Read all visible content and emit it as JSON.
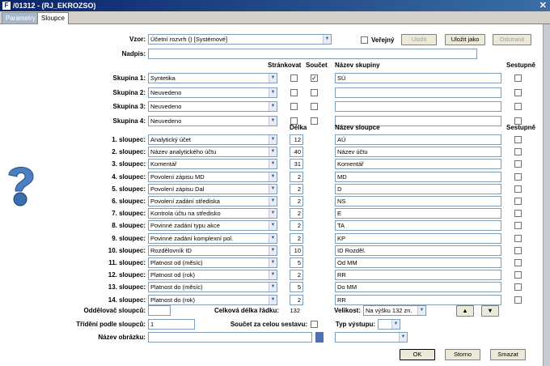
{
  "window": {
    "title": "/01312 - (RJ_EKROZSO)",
    "close_glyph": "✕"
  },
  "tabs": [
    {
      "label": "Parametry"
    },
    {
      "label": "Sloupce"
    }
  ],
  "vzor": {
    "label": "Vzor:",
    "value": "Účetní rozvrh   ()   [Systémové]",
    "verejny_label": "Veřejný",
    "uloz_label": "Uložit",
    "uloz_jako_label": "Uložit jako",
    "odstranit_label": "Odstranit"
  },
  "nadpis": {
    "label": "Nadpis:",
    "value": ""
  },
  "group_headers": {
    "strankovat": "Stránkovat",
    "soucet": "Součet",
    "nazev_skupiny": "Název skupiny",
    "sestupne": "Sestupně"
  },
  "groups": [
    {
      "label": "Skupina 1:",
      "value": "Syntetika",
      "strankovat": false,
      "soucet": true,
      "name": "SÚ",
      "sestupne": false
    },
    {
      "label": "Skupina 2:",
      "value": "Neuvedeno",
      "strankovat": false,
      "soucet": false,
      "name": "",
      "sestupne": false
    },
    {
      "label": "Skupina 3:",
      "value": "Neuvedeno",
      "strankovat": false,
      "soucet": false,
      "name": "",
      "sestupne": false
    },
    {
      "label": "Skupina 4:",
      "value": "Neuvedeno",
      "strankovat": false,
      "soucet": false,
      "name": "",
      "sestupne": false
    }
  ],
  "column_headers": {
    "delka": "Délka",
    "nazev_sloupce": "Název sloupce",
    "sestupne": "Sestupně"
  },
  "columns": [
    {
      "label": "1. sloupec:",
      "value": "Analytický účet",
      "delka": "12",
      "name": "AÚ"
    },
    {
      "label": "2. sloupec:",
      "value": "Název analytického účtu",
      "delka": "40",
      "name": "Název účtu"
    },
    {
      "label": "3. sloupec:",
      "value": "Komentář",
      "delka": "31",
      "name": "Komentář"
    },
    {
      "label": "4. sloupec:",
      "value": "Povolení zápisu MD",
      "delka": "2",
      "name": "MD"
    },
    {
      "label": "5. sloupec:",
      "value": "Povolení zápisu Dal",
      "delka": "2",
      "name": "D"
    },
    {
      "label": "6. sloupec:",
      "value": "Povolení zadání střediska",
      "delka": "2",
      "name": "NS"
    },
    {
      "label": "7. sloupec:",
      "value": "Kontrola účtu na středisko",
      "delka": "2",
      "name": "E"
    },
    {
      "label": "8. sloupec:",
      "value": "Povinné zadání typu akce",
      "delka": "2",
      "name": "TA"
    },
    {
      "label": "9. sloupec:",
      "value": "Povinné zadání komplexní pol.",
      "delka": "2",
      "name": "KP"
    },
    {
      "label": "10. sloupec:",
      "value": "Rozdělovník ID",
      "delka": "10",
      "name": "ID Rozděl."
    },
    {
      "label": "11. sloupec:",
      "value": "Platnost od (měsíc)",
      "delka": "5",
      "name": "Od MM"
    },
    {
      "label": "12. sloupec:",
      "value": "Platnost od (rok)",
      "delka": "2",
      "name": "RR"
    },
    {
      "label": "13. sloupec:",
      "value": "Platnost do (měsíc)",
      "delka": "5",
      "name": "Do MM"
    },
    {
      "label": "14. sloupec:",
      "value": "Platnost do (rok)",
      "delka": "2",
      "name": "RR"
    }
  ],
  "bottom": {
    "oddelovac_label": "Oddělovač sloupců:",
    "oddelovac_value": "",
    "celkova_label": "Celková délka řádku:",
    "celkova_value": "132",
    "velikost_label": "Velikost:",
    "velikost_value": "Na výšku 132 zn.",
    "trideni_label": "Třídění podle sloupců:",
    "trideni_value": "1",
    "soucet_label": "Součet za celou sestavu:",
    "typ_label": "Typ výstupu:",
    "typ_value": "",
    "obrazek_label": "Název obrázku:",
    "obrazek_value": "",
    "up_glyph": "▲",
    "down_glyph": "▼",
    "ok_label": "OK",
    "storno_label": "Storno",
    "smazat_label": "Smazat"
  }
}
